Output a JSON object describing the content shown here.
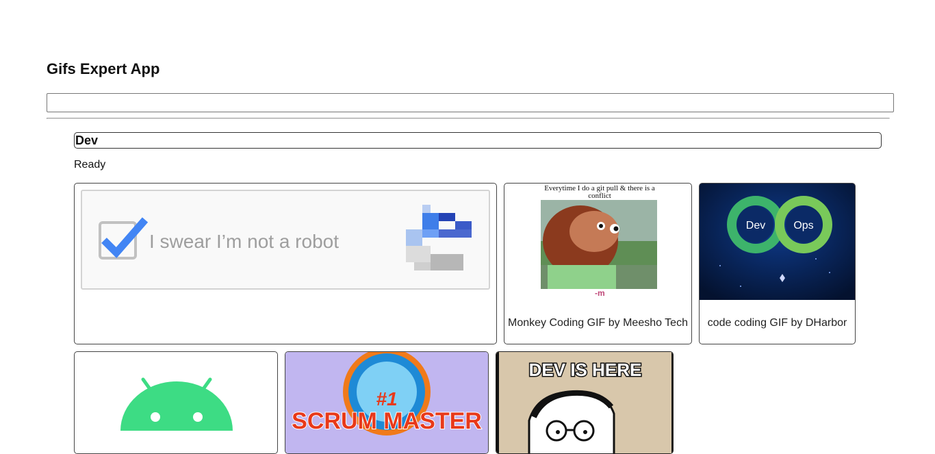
{
  "app": {
    "title": "Gifs Expert App"
  },
  "search": {
    "value": "",
    "placeholder": ""
  },
  "category": {
    "title": "Dev",
    "status": "Ready",
    "gifs": [
      {
        "title": "",
        "image_text": "I swear I’m not a robot"
      },
      {
        "title": "Monkey Coding GIF by Meesho Tech",
        "image_text": "Everytime I do a git pull & there is a conflict"
      },
      {
        "title": "code coding GIF by DHarbor",
        "image_labels": [
          "Dev",
          "Ops"
        ]
      },
      {
        "title": ""
      },
      {
        "title": "",
        "image_text": "SCRUM MASTER",
        "badge": "#1"
      },
      {
        "title": "",
        "image_text": "DEV IS HERE"
      }
    ]
  },
  "colors": {
    "checkbox_blue": "#4285f4",
    "android_green": "#3ddc84",
    "devops_bg": "#061a45",
    "scrum_bg": "#c1b6f0"
  }
}
